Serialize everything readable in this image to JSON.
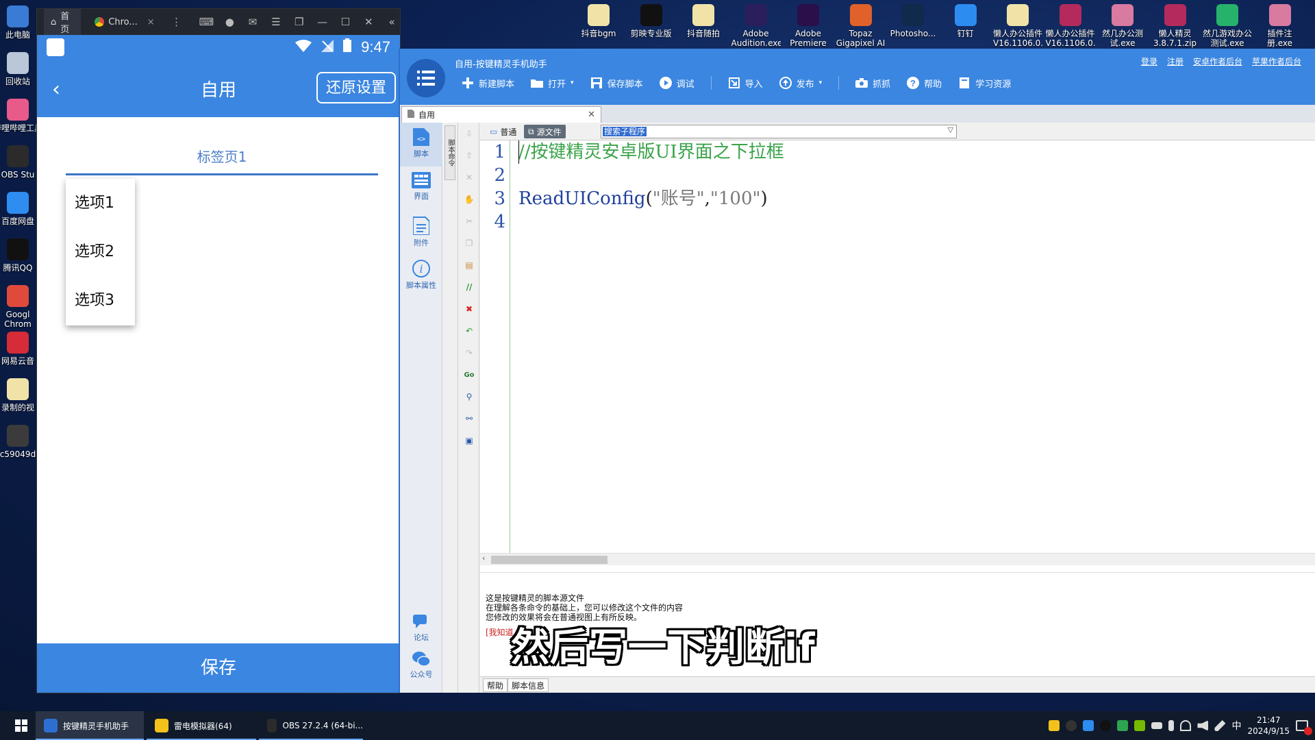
{
  "desktop": {
    "left_icons": [
      {
        "label": "此电脑",
        "color": "#3a7bd5"
      },
      {
        "label": "回收站",
        "color": "#b9c7d9"
      },
      {
        "label": "哔哩哔哩工具",
        "color": "#e85a8a"
      },
      {
        "label": "OBS Stu",
        "color": "#2b2b2b"
      },
      {
        "label": "百度网盘",
        "color": "#2f8df0"
      },
      {
        "label": "腾讯QQ",
        "color": "#111111"
      },
      {
        "label": "Googl Chrom",
        "color": "#e04a3a"
      },
      {
        "label": "网易云音",
        "color": "#d62b38"
      },
      {
        "label": "录制的视",
        "color": "#f1e3a8"
      },
      {
        "label": "c59049d",
        "color": "#3b3b3b"
      }
    ],
    "top_icons": [
      {
        "label": "抖音bgm",
        "color": "#f1e3a8"
      },
      {
        "label": "剪映专业版",
        "color": "#111111"
      },
      {
        "label": "抖音随拍",
        "color": "#f1e3a8"
      },
      {
        "label": "Adobe Audition.exe",
        "color": "#2a1e5c"
      },
      {
        "label": "Adobe Premiere P...",
        "color": "#2a0f4a"
      },
      {
        "label": "Topaz Gigapixel AI",
        "color": "#e0622a"
      },
      {
        "label": "Photosho...",
        "color": "#0f2a4a"
      },
      {
        "label": "钉钉",
        "color": "#2d8cf0"
      },
      {
        "label": "懒人办公插件 V16.1106.0...",
        "color": "#f1e3a8"
      },
      {
        "label": "懒人办公插件 V16.1106.0...",
        "color": "#b52a5c"
      },
      {
        "label": "然几办公测试.exe",
        "color": "#d97aa0"
      },
      {
        "label": "懒人精灵 3.8.7.1.zip",
        "color": "#b52a5c"
      },
      {
        "label": "然几游戏办公测试.exe",
        "color": "#26b26a"
      },
      {
        "label": "插件注册.exe",
        "color": "#d97aa0"
      }
    ]
  },
  "emulator": {
    "window_tabs": [
      {
        "label": "首页"
      },
      {
        "label": "Chro..."
      }
    ],
    "status": {
      "time": "9:47"
    },
    "appbar": {
      "back": "‹",
      "title": "自用",
      "restore_button": "还原设置"
    },
    "tab": {
      "label": "标签页1"
    },
    "dropdown_options": [
      "选项1",
      "选项2",
      "选项3"
    ],
    "save_button": "保存"
  },
  "ide": {
    "window_title": "自用-按键精灵手机助手",
    "top_links": [
      "登录",
      "注册",
      "安卓作者后台",
      "苹果作者后台"
    ],
    "toolbar": [
      {
        "label": "新建脚本",
        "icon": "plus-icon"
      },
      {
        "label": "打开",
        "icon": "folder-icon"
      },
      {
        "label": "保存脚本",
        "icon": "save-icon"
      },
      {
        "label": "调试",
        "icon": "play-icon"
      },
      {
        "label": "导入",
        "icon": "import-icon"
      },
      {
        "label": "发布",
        "icon": "publish-icon"
      },
      {
        "label": "抓抓",
        "icon": "camera-icon"
      },
      {
        "label": "帮助",
        "icon": "help-icon"
      },
      {
        "label": "学习资源",
        "icon": "book-icon"
      }
    ],
    "doc_tab": "自用",
    "side_nav": [
      {
        "label": "脚本",
        "active": true
      },
      {
        "label": "界面",
        "active": false
      },
      {
        "label": "附件",
        "active": false
      },
      {
        "label": "脚本属性",
        "active": false
      }
    ],
    "side_nav_bottom": [
      {
        "label": "论坛"
      },
      {
        "label": "公众号"
      }
    ],
    "command_strip": "脚本命令",
    "mode": {
      "normal": "普通",
      "source": "源文件"
    },
    "search_combo": "搜索子程序",
    "code_lines": [
      {
        "num": "1",
        "parts": [
          {
            "t": "//按键精灵安卓版UI界面之下拉框",
            "c": "#3aa34a"
          }
        ]
      },
      {
        "num": "2",
        "parts": []
      },
      {
        "num": "3",
        "parts": [
          {
            "t": "ReadUIConfig",
            "c": "#1f3f9c"
          },
          {
            "t": "(",
            "c": "#222222"
          },
          {
            "t": "\"账号\"",
            "c": "#7a7a7a"
          },
          {
            "t": ",",
            "c": "#222222"
          },
          {
            "t": "\"100\"",
            "c": "#7a7a7a"
          },
          {
            "t": ")",
            "c": "#222222"
          }
        ]
      },
      {
        "num": "4",
        "parts": []
      }
    ],
    "info": {
      "line1": "这是按键精灵的脚本源文件",
      "line2": "在理解各条命令的基础上，您可以修改这个文件的内容",
      "line3": "您修改的效果将会在普通视图上有所反映。",
      "link": "[我知道"
    },
    "bottom_tabs": [
      "帮助",
      "脚本信息"
    ]
  },
  "subtitle": "然后写一下判断if",
  "taskbar": {
    "tasks": [
      {
        "label": "按键精灵手机助手",
        "color": "#2d6fd0"
      },
      {
        "label": "雷电模拟器(64)",
        "color": "#f2c21b"
      },
      {
        "label": "OBS 27.2.4 (64-bi...",
        "color": "#2b2b2b"
      }
    ],
    "ime": "中",
    "time": "21:47",
    "date": "2024/9/15"
  }
}
